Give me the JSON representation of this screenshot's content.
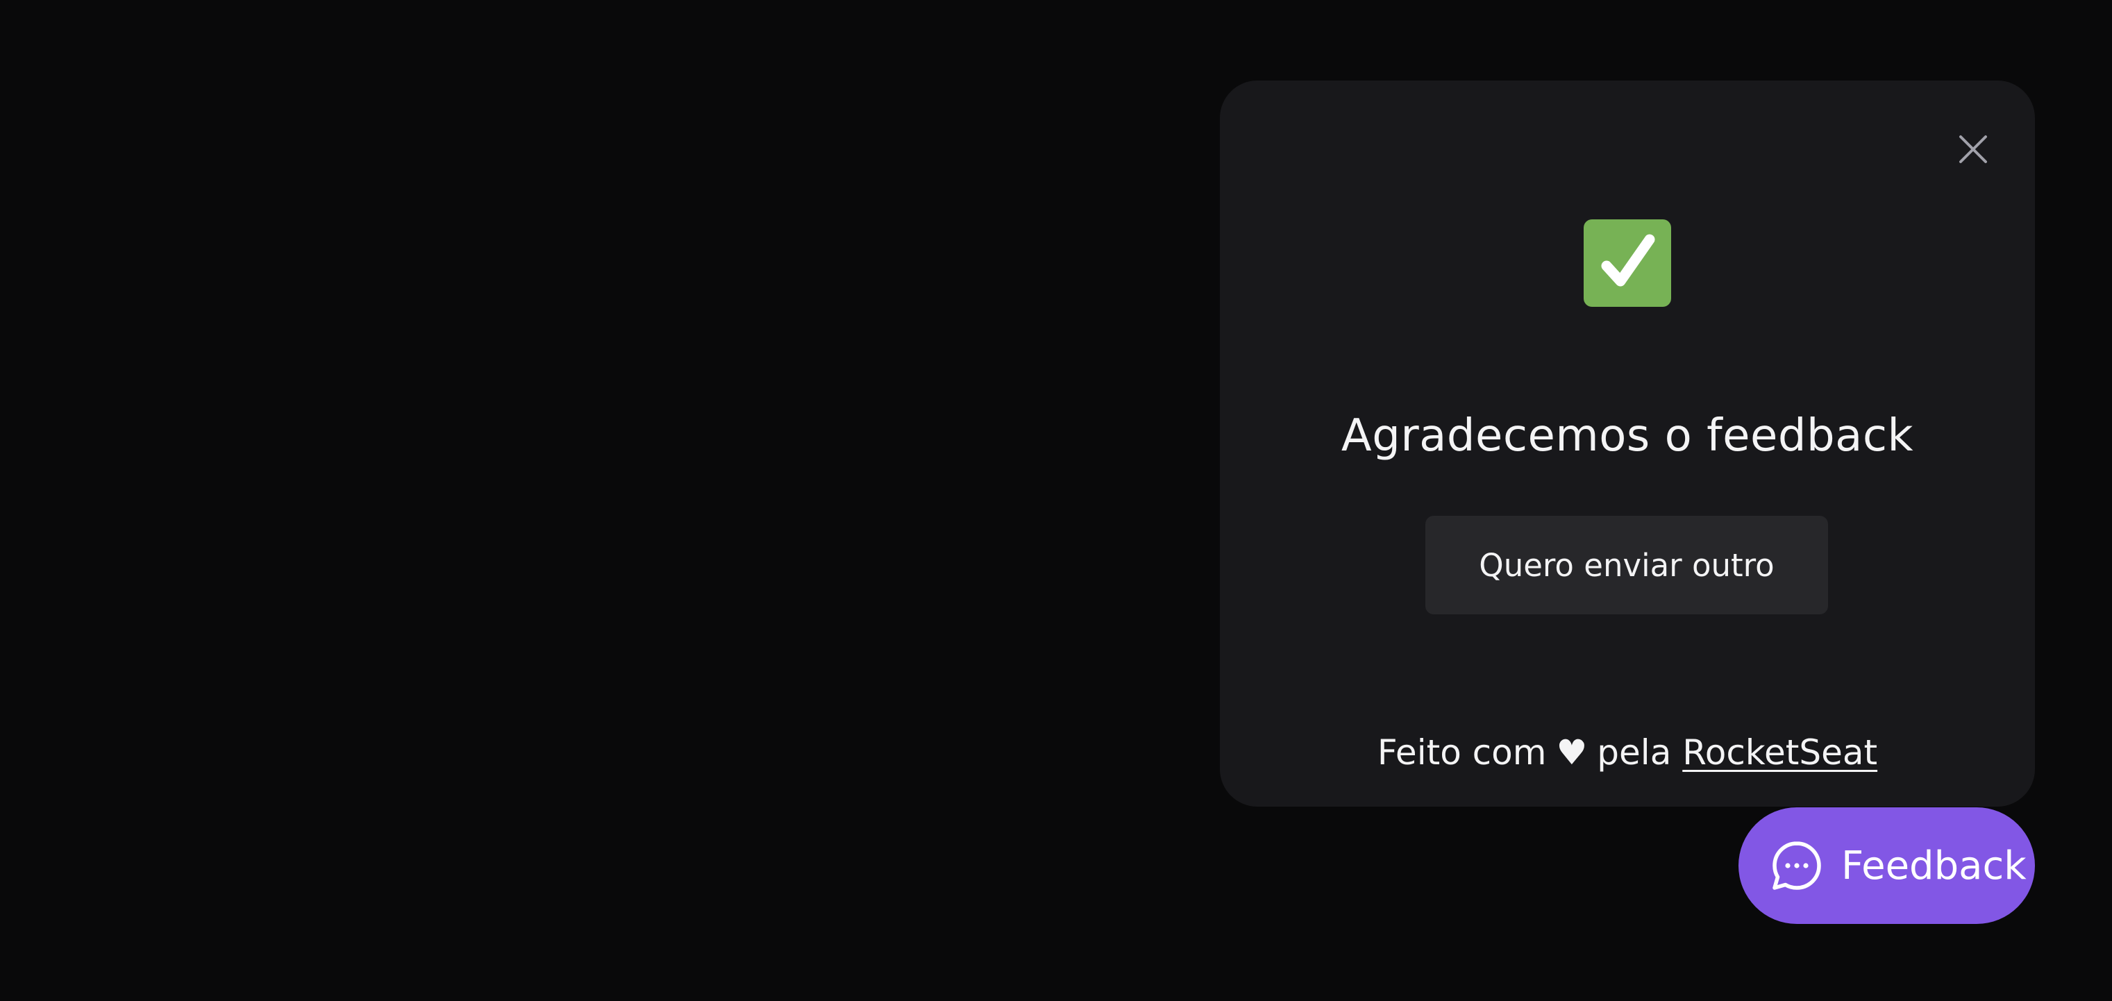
{
  "widget": {
    "close_label": "Fechar formulário de feedback",
    "success_icon": "check-mark-emoji",
    "title": "Agradecemos o feedback",
    "restart_button_label": "Quero enviar outro",
    "footer": {
      "prefix": "Feito com",
      "heart": "♥",
      "middle": "pela",
      "link_text": "RocketSeat"
    }
  },
  "launcher": {
    "label": "Feedback",
    "icon": "chat-bubble-icon"
  },
  "colors": {
    "background": "#09090a",
    "card": "#18181b",
    "button": "#27272a",
    "brand": "#8257e5",
    "success": "#77b255",
    "text": "#f4f4f5"
  }
}
